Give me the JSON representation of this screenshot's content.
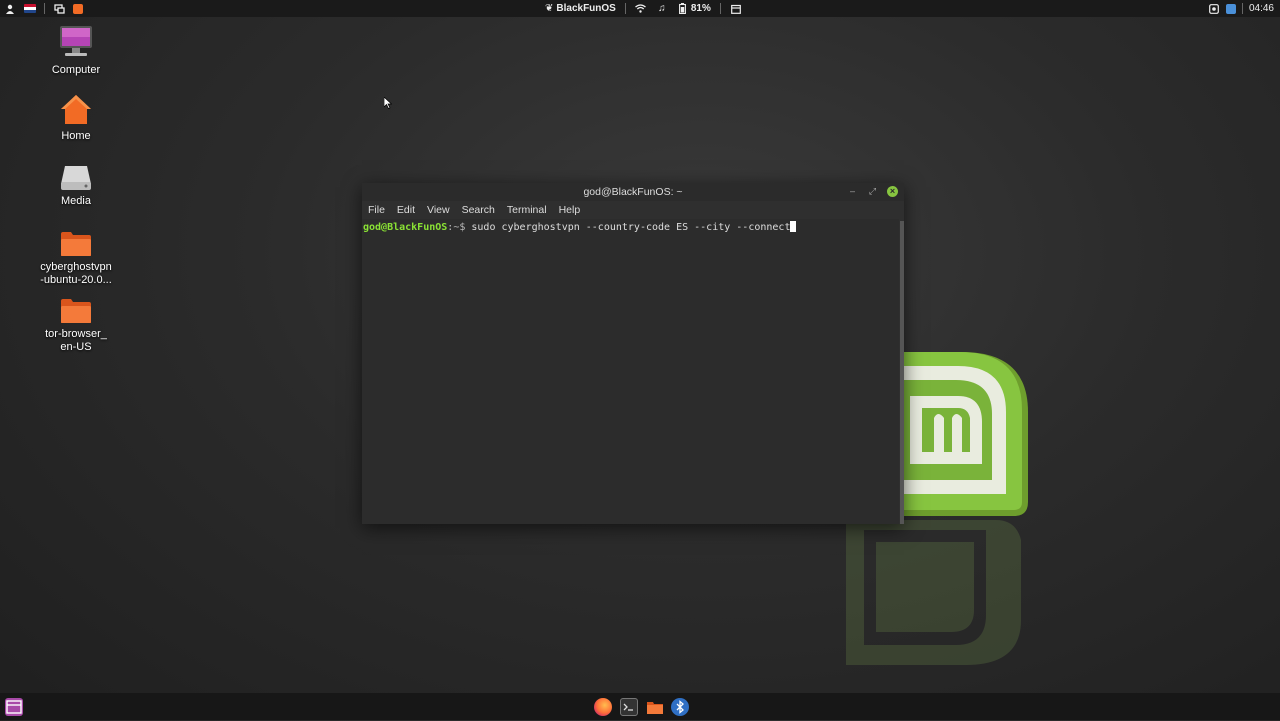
{
  "top_panel": {
    "title": "BlackFunOS",
    "battery": "81%",
    "clock": "04:46",
    "icons": [
      "user-icon",
      "flag-icon",
      "window-list-icon",
      "mail-icon",
      "mint-leaf-icon",
      "wifi-icon",
      "music-icon",
      "battery-icon",
      "calendar-icon",
      "screenshot-icon",
      "camera-icon"
    ]
  },
  "desktop": {
    "icons": [
      {
        "label_1": "Computer",
        "label_2": ""
      },
      {
        "label_1": "Home",
        "label_2": ""
      },
      {
        "label_1": "Media",
        "label_2": ""
      },
      {
        "label_1": "cyberghostvpn",
        "label_2": "-ubuntu-20.0..."
      },
      {
        "label_1": "tor-browser_",
        "label_2": "en-US"
      }
    ]
  },
  "terminal": {
    "title": "god@BlackFunOS: ~",
    "menu": [
      "File",
      "Edit",
      "View",
      "Search",
      "Terminal",
      "Help"
    ],
    "prompt_user": "god@BlackFunOS",
    "prompt_path": ":~$",
    "command": " sudo cyberghostvpn --country-code ES --city --connect"
  },
  "taskbar": {
    "icons": [
      "menu-icon",
      "firefox-icon",
      "terminal-icon",
      "files-icon",
      "bluetooth-icon"
    ]
  },
  "colors": {
    "prompt_green": "#8ae234",
    "mint_green": "#87c540",
    "folder_orange": "#f26b25"
  }
}
